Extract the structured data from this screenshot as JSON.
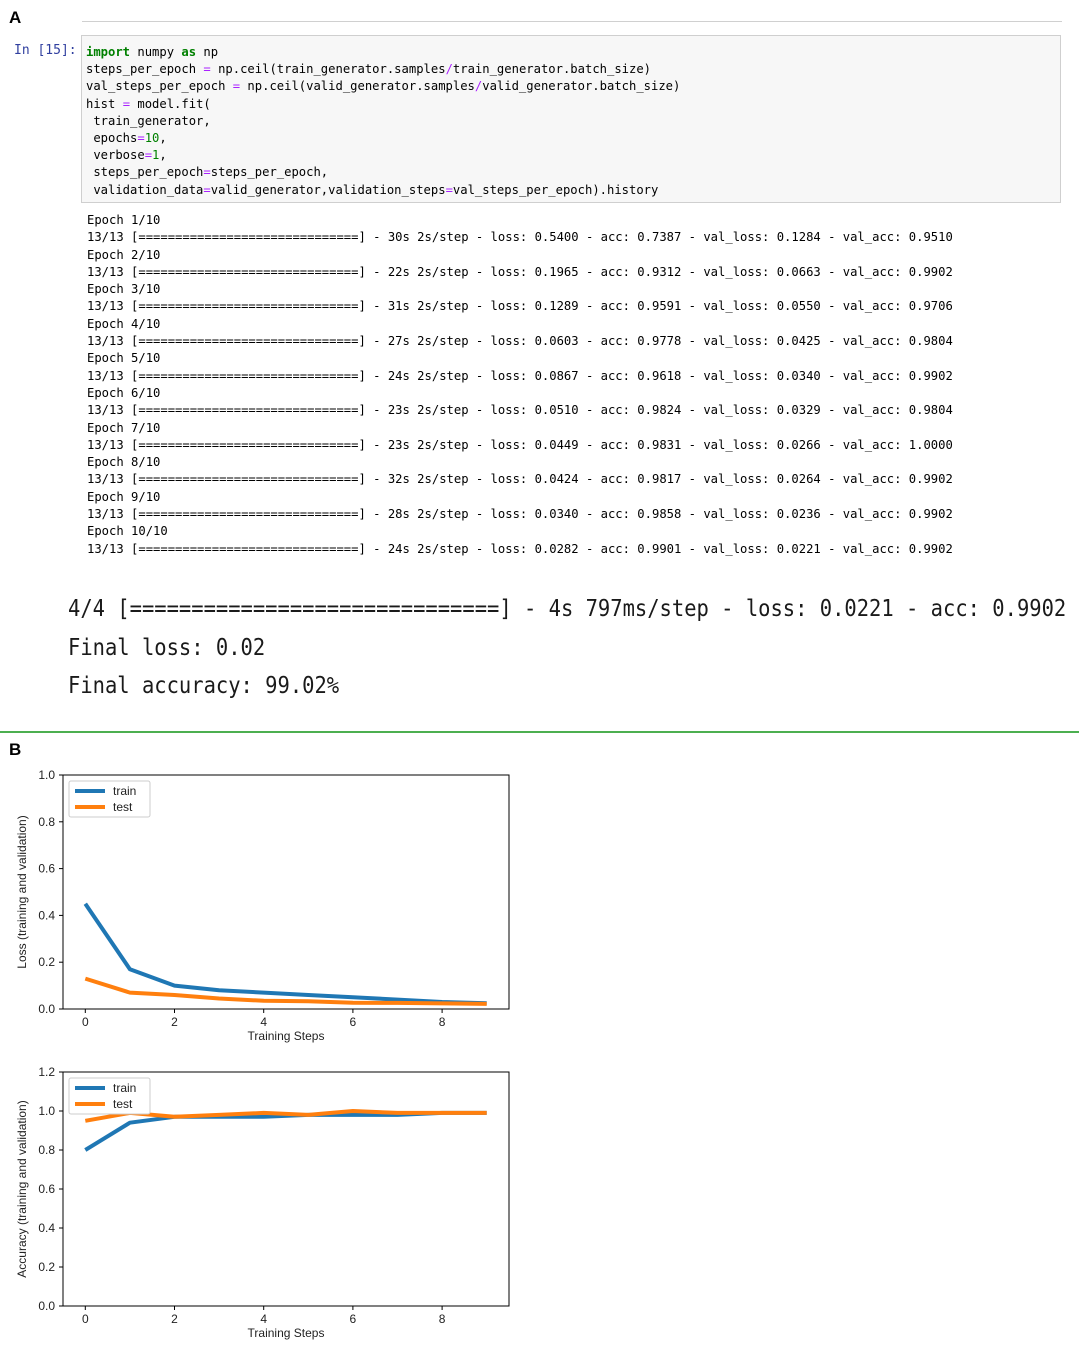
{
  "panels": {
    "a": "A",
    "b": "B"
  },
  "notebook": {
    "prompt": "In [15]:",
    "code_lines": [
      [
        {
          "t": "import",
          "c": "kw"
        },
        {
          "t": " numpy "
        },
        {
          "t": "as",
          "c": "kw"
        },
        {
          "t": " np"
        }
      ],
      [
        {
          "t": "steps_per_epoch "
        },
        {
          "t": "=",
          "c": "op"
        },
        {
          "t": " np.ceil(train_generator.samples"
        },
        {
          "t": "/",
          "c": "op"
        },
        {
          "t": "train_generator.batch_size)"
        }
      ],
      [
        {
          "t": "val_steps_per_epoch "
        },
        {
          "t": "=",
          "c": "op"
        },
        {
          "t": " np.ceil(valid_generator.samples"
        },
        {
          "t": "/",
          "c": "op"
        },
        {
          "t": "valid_generator.batch_size)"
        }
      ],
      [
        {
          "t": "hist "
        },
        {
          "t": "=",
          "c": "op"
        },
        {
          "t": " model.fit("
        }
      ],
      [
        {
          "t": " train_generator,"
        }
      ],
      [
        {
          "t": " epochs"
        },
        {
          "t": "=",
          "c": "op"
        },
        {
          "t": "10",
          "c": "num"
        },
        {
          "t": ","
        }
      ],
      [
        {
          "t": " verbose"
        },
        {
          "t": "=",
          "c": "op"
        },
        {
          "t": "1",
          "c": "num"
        },
        {
          "t": ","
        }
      ],
      [
        {
          "t": " steps_per_epoch"
        },
        {
          "t": "=",
          "c": "op"
        },
        {
          "t": "steps_per_epoch,"
        }
      ],
      [
        {
          "t": " validation_data"
        },
        {
          "t": "=",
          "c": "op"
        },
        {
          "t": "valid_generator,validation_steps"
        },
        {
          "t": "=",
          "c": "op"
        },
        {
          "t": "val_steps_per_epoch).history"
        }
      ]
    ],
    "output_lines": [
      "Epoch 1/10",
      "13/13 [==============================] - 30s 2s/step - loss: 0.5400 - acc: 0.7387 - val_loss: 0.1284 - val_acc: 0.9510",
      "Epoch 2/10",
      "13/13 [==============================] - 22s 2s/step - loss: 0.1965 - acc: 0.9312 - val_loss: 0.0663 - val_acc: 0.9902",
      "Epoch 3/10",
      "13/13 [==============================] - 31s 2s/step - loss: 0.1289 - acc: 0.9591 - val_loss: 0.0550 - val_acc: 0.9706",
      "Epoch 4/10",
      "13/13 [==============================] - 27s 2s/step - loss: 0.0603 - acc: 0.9778 - val_loss: 0.0425 - val_acc: 0.9804",
      "Epoch 5/10",
      "13/13 [==============================] - 24s 2s/step - loss: 0.0867 - acc: 0.9618 - val_loss: 0.0340 - val_acc: 0.9902",
      "Epoch 6/10",
      "13/13 [==============================] - 23s 2s/step - loss: 0.0510 - acc: 0.9824 - val_loss: 0.0329 - val_acc: 0.9804",
      "Epoch 7/10",
      "13/13 [==============================] - 23s 2s/step - loss: 0.0449 - acc: 0.9831 - val_loss: 0.0266 - val_acc: 1.0000",
      "Epoch 8/10",
      "13/13 [==============================] - 32s 2s/step - loss: 0.0424 - acc: 0.9817 - val_loss: 0.0264 - val_acc: 0.9902",
      "Epoch 9/10",
      "13/13 [==============================] - 28s 2s/step - loss: 0.0340 - acc: 0.9858 - val_loss: 0.0236 - val_acc: 0.9902",
      "Epoch 10/10",
      "13/13 [==============================] - 24s 2s/step - loss: 0.0282 - acc: 0.9901 - val_loss: 0.0221 - val_acc: 0.9902"
    ],
    "eval_lines": [
      "4/4 [==============================] - 4s 797ms/step - loss: 0.0221 - acc: 0.9902",
      "Final loss: 0.02",
      "Final accuracy: 99.02%"
    ]
  },
  "colors": {
    "train": "#1f77b4",
    "test": "#ff7f0e"
  },
  "chart_data": [
    {
      "type": "line",
      "title": "",
      "xlabel": "Training Steps",
      "ylabel": "Loss (training and validation)",
      "x": [
        0,
        1,
        2,
        3,
        4,
        5,
        6,
        7,
        8,
        9
      ],
      "xticks": [
        0,
        2,
        4,
        6,
        8
      ],
      "yticks": [
        0.0,
        0.2,
        0.4,
        0.6,
        0.8,
        1.0
      ],
      "ytick_labels": [
        "0.0",
        "0.2",
        "0.4",
        "0.6",
        "0.8",
        "1.0"
      ],
      "xlim": [
        -0.5,
        9.5
      ],
      "ylim": [
        0,
        1.0
      ],
      "legend_position": "upper-left",
      "series": [
        {
          "name": "train",
          "values": [
            0.45,
            0.17,
            0.1,
            0.08,
            0.07,
            0.06,
            0.05,
            0.04,
            0.03,
            0.025
          ]
        },
        {
          "name": "test",
          "values": [
            0.13,
            0.07,
            0.06,
            0.045,
            0.035,
            0.033,
            0.027,
            0.026,
            0.024,
            0.022
          ]
        }
      ]
    },
    {
      "type": "line",
      "title": "",
      "xlabel": "Training Steps",
      "ylabel": "Accuracy (training and validation)",
      "x": [
        0,
        1,
        2,
        3,
        4,
        5,
        6,
        7,
        8,
        9
      ],
      "xticks": [
        0,
        2,
        4,
        6,
        8
      ],
      "yticks": [
        0.0,
        0.2,
        0.4,
        0.6,
        0.8,
        1.0,
        1.2
      ],
      "ytick_labels": [
        "0.0",
        "0.2",
        "0.4",
        "0.6",
        "0.8",
        "1.0",
        "1.2"
      ],
      "xlim": [
        -0.5,
        9.5
      ],
      "ylim": [
        0,
        1.2
      ],
      "legend_position": "upper-left",
      "series": [
        {
          "name": "train",
          "values": [
            0.8,
            0.94,
            0.97,
            0.97,
            0.97,
            0.98,
            0.98,
            0.98,
            0.99,
            0.99
          ]
        },
        {
          "name": "test",
          "values": [
            0.95,
            0.99,
            0.97,
            0.98,
            0.99,
            0.98,
            1.0,
            0.99,
            0.99,
            0.99
          ]
        }
      ]
    }
  ]
}
